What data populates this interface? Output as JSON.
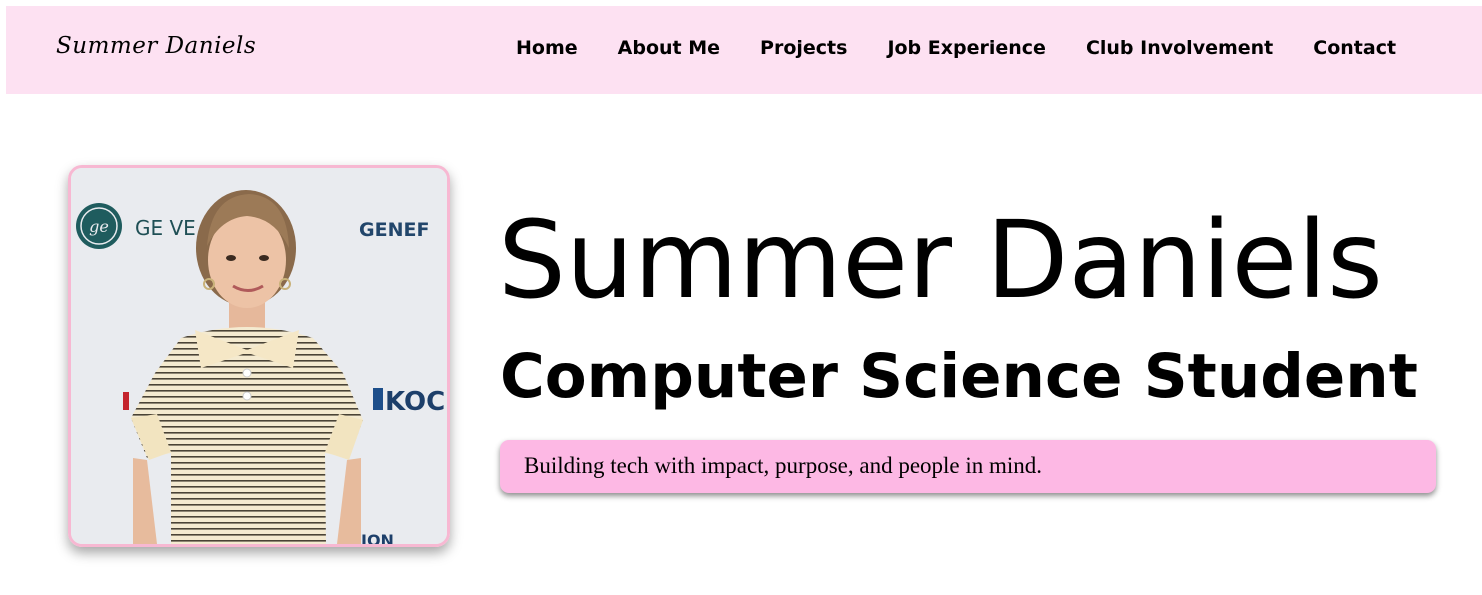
{
  "nav": {
    "brand": "Summer Daniels",
    "links": [
      "Home",
      "About Me",
      "Projects",
      "Job Experience",
      "Club Involvement",
      "Contact"
    ]
  },
  "hero": {
    "name": "Summer Daniels",
    "title": "Computer Science Student",
    "tagline": "Building tech with impact, purpose, and people in mind.",
    "photo": {
      "backdrop_text_left": "GE VE",
      "backdrop_text_right": "GENEF",
      "backdrop_text_mid": "KOC",
      "backdrop_text_bottom": "ION"
    }
  },
  "colors": {
    "nav_bg": "#fde1f2",
    "tagline_bg": "#fdb8e4",
    "photo_border": "#f7b8d2"
  }
}
